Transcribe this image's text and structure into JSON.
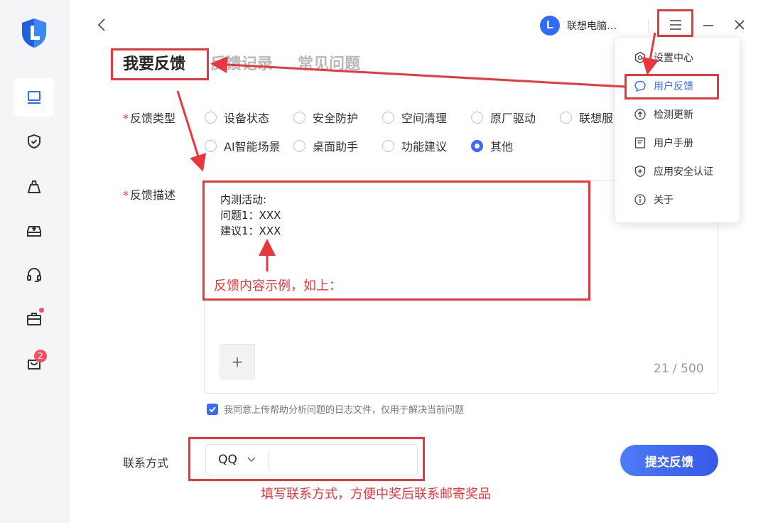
{
  "header": {
    "account_initial": "L",
    "account_name": "联想电脑…"
  },
  "tabs": [
    {
      "label": "我要反馈",
      "active": true
    },
    {
      "label": "反馈记录",
      "active": false
    },
    {
      "label": "常见问题",
      "active": false
    }
  ],
  "sidebar": {
    "notification_count": "2"
  },
  "form": {
    "type_label": "反馈类型",
    "required_mark": "*",
    "options": [
      "设备状态",
      "安全防护",
      "空间清理",
      "原厂驱动",
      "联想服",
      "AI智能场景",
      "桌面助手",
      "功能建议",
      "其他"
    ],
    "selected_option": "其他",
    "desc_label": "反馈描述",
    "desc_value": "内测活动:\n问题1：XXX\n建议1：XXX",
    "add_label": "+",
    "counter": "21 / 500",
    "consent_text": "我同意上传帮助分析问题的日志文件，仅用于解决当前问题",
    "contact_label": "联系方式",
    "contact_type": "QQ",
    "contact_value": "",
    "submit_label": "提交反馈"
  },
  "menu": {
    "items": [
      {
        "label": "设置中心",
        "icon": "settings-icon"
      },
      {
        "label": "用户反馈",
        "icon": "chat-icon",
        "active": true
      },
      {
        "label": "检测更新",
        "icon": "update-icon"
      },
      {
        "label": "用户手册",
        "icon": "manual-icon"
      },
      {
        "label": "应用安全认证",
        "icon": "shield-plus-icon"
      },
      {
        "label": "关于",
        "icon": "info-icon"
      }
    ]
  },
  "annotations": {
    "example_note": "反馈内容示例，如上：",
    "contact_note": "填写联系方式，方便中奖后联系邮寄奖品"
  },
  "colors": {
    "accent": "#3a6bf5",
    "annotation_red": "#e8383d",
    "badge_red": "#f5515f"
  }
}
